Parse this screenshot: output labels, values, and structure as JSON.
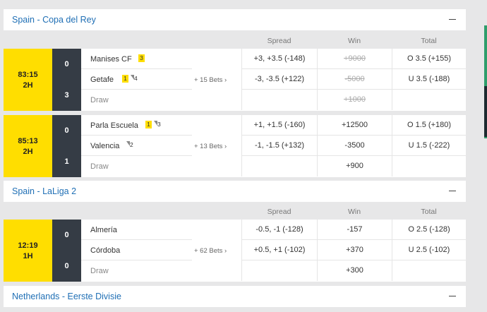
{
  "columns": {
    "spread": "Spread",
    "win": "Win",
    "total": "Total"
  },
  "leagues": [
    {
      "title": "Spain - Copa del Rey",
      "matches": [
        {
          "time": "83:15",
          "period": "2H",
          "home": {
            "name": "Manises CF",
            "score": "0",
            "yellow": "3",
            "flag": ""
          },
          "away": {
            "name": "Getafe",
            "score": "3",
            "yellow": "1",
            "flag": "4"
          },
          "draw_label": "Draw",
          "bets": "+ 15 Bets",
          "spread": [
            "+3, +3.5 (-148)",
            "-3, -3.5 (+122)",
            ""
          ],
          "win": [
            "+9000",
            "-5000",
            "+1000"
          ],
          "total": [
            "O 3.5 (+155)",
            "U 3.5 (-188)",
            ""
          ]
        },
        {
          "time": "85:13",
          "period": "2H",
          "home": {
            "name": "Parla Escuela",
            "score": "0",
            "yellow": "1",
            "flag": "3"
          },
          "away": {
            "name": "Valencia",
            "score": "1",
            "yellow": "",
            "flag": "2"
          },
          "draw_label": "Draw",
          "bets": "+ 13 Bets",
          "spread": [
            "+1, +1.5 (-160)",
            "-1, -1.5 (+132)",
            ""
          ],
          "win": [
            "+12500",
            "-3500",
            "+900"
          ],
          "total": [
            "O 1.5 (+180)",
            "U 1.5 (-222)",
            ""
          ]
        }
      ]
    },
    {
      "title": "Spain - LaLiga 2",
      "matches": [
        {
          "time": "12:19",
          "period": "1H",
          "home": {
            "name": "Almería",
            "score": "0",
            "yellow": "",
            "flag": ""
          },
          "away": {
            "name": "Córdoba",
            "score": "0",
            "yellow": "",
            "flag": ""
          },
          "draw_label": "Draw",
          "bets": "+ 62 Bets",
          "spread": [
            "-0.5, -1 (-128)",
            "+0.5, +1 (-102)",
            ""
          ],
          "win": [
            "-157",
            "+370",
            "+300"
          ],
          "total": [
            "O 2.5 (-128)",
            "U 2.5 (-102)",
            ""
          ]
        }
      ]
    },
    {
      "title": "Netherlands - Eerste Divisie",
      "matches": []
    }
  ]
}
